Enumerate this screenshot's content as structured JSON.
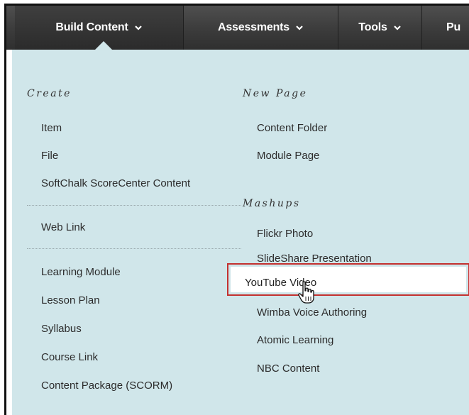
{
  "nav": {
    "tabs": [
      {
        "label": "Build Content"
      },
      {
        "label": "Assessments"
      },
      {
        "label": "Tools"
      },
      {
        "label": "Pu"
      }
    ]
  },
  "menu": {
    "create": {
      "heading": "Create",
      "items": [
        "Item",
        "File",
        "SoftChalk ScoreCenter Content"
      ],
      "items2": [
        "Web Link"
      ],
      "items3": [
        "Learning Module",
        "Lesson Plan",
        "Syllabus",
        "Course Link",
        "Content Package (SCORM)"
      ]
    },
    "new_page": {
      "heading": "New Page",
      "items": [
        "Content Folder",
        "Module Page"
      ]
    },
    "mashups": {
      "heading": "Mashups",
      "items": [
        "Flickr Photo",
        "SlideShare Presentation",
        "YouTube Video",
        "Wimba Voice Authoring",
        "Atomic Learning",
        "NBC Content"
      ]
    }
  },
  "colors": {
    "panel": "#d0e6ea",
    "topbar": "#3d3d3d",
    "highlight_border": "#c4312f"
  }
}
